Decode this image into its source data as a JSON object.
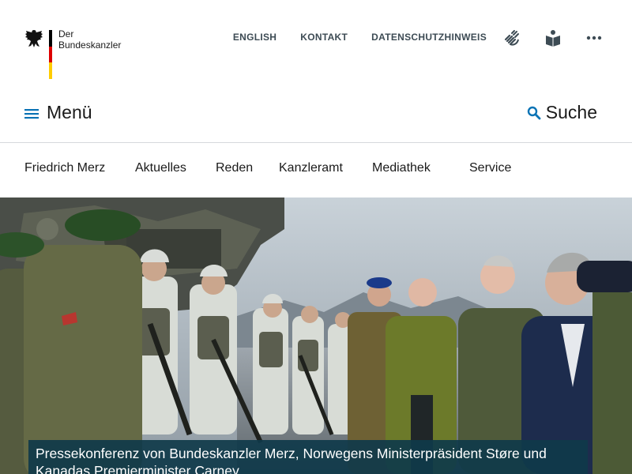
{
  "logo": {
    "line1": "Der",
    "line2": "Bundeskanzler",
    "flag_colors": [
      "#000000",
      "#dd0000",
      "#ffcc00"
    ]
  },
  "top_nav": {
    "links": [
      "ENGLISH",
      "KONTAKT",
      "DATENSCHUTZHINWEIS"
    ],
    "icons": [
      "sign-language-icon",
      "easy-language-icon",
      "more-options-icon"
    ]
  },
  "menu": {
    "label": "Menü"
  },
  "search": {
    "label": "Suche"
  },
  "main_nav": {
    "items": [
      "Friedrich Merz",
      "Aktuelles",
      "Reden",
      "Kanzleramt",
      "Mediathek",
      "Service"
    ]
  },
  "hero": {
    "caption": "Pressekonferenz von Bundeskanzler Merz, Norwegens Ministerpräsident Støre und Kanadas Premierminister Carney"
  },
  "colors": {
    "accent": "#0a73b5",
    "caption_bg": "#0f3a4a",
    "text": "#1a1a1a"
  }
}
